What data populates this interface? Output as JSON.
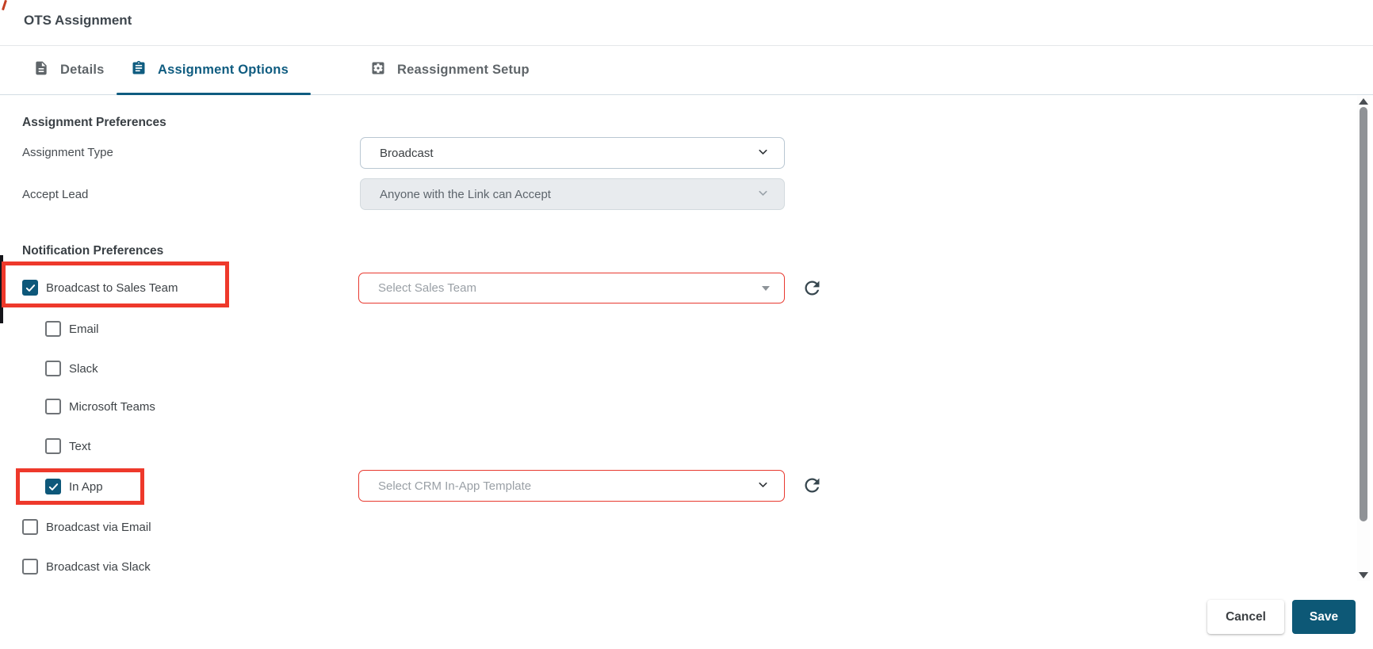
{
  "window": {
    "title": "OTS Assignment"
  },
  "tabs": {
    "details": {
      "label": "Details",
      "active": false
    },
    "assignment_options": {
      "label": "Assignment Options",
      "active": true
    },
    "reassignment_setup": {
      "label": "Reassignment Setup",
      "active": false
    }
  },
  "assignment_preferences": {
    "title": "Assignment Preferences",
    "assignment_type": {
      "label": "Assignment Type",
      "value": "Broadcast",
      "disabled": false
    },
    "accept_lead": {
      "label": "Accept Lead",
      "value": "Anyone with the Link can Accept",
      "disabled": true
    }
  },
  "notification_preferences": {
    "title": "Notification Preferences",
    "broadcast_to_sales_team": {
      "label": "Broadcast to Sales Team",
      "checked": true,
      "annotated": true
    },
    "sales_team_select": {
      "placeholder": "Select Sales Team",
      "error": true
    },
    "email": {
      "label": "Email",
      "checked": false
    },
    "slack": {
      "label": "Slack",
      "checked": false
    },
    "microsoft_teams": {
      "label": "Microsoft Teams",
      "checked": false
    },
    "text": {
      "label": "Text",
      "checked": false
    },
    "in_app": {
      "label": "In App",
      "checked": true,
      "annotated": true
    },
    "crm_template_select": {
      "placeholder": "Select CRM In-App Template",
      "error": true
    },
    "broadcast_via_email": {
      "label": "Broadcast via Email",
      "checked": false
    },
    "broadcast_via_slack": {
      "label": "Broadcast via Slack",
      "checked": false
    }
  },
  "footer": {
    "cancel_label": "Cancel",
    "save_label": "Save"
  },
  "colors": {
    "accent_teal": "#0e587a",
    "active_tab": "#0f5c80",
    "annotation_red": "#ee392b",
    "error_border_red": "#e8392f",
    "disabled_field_bg": "#e8ebee"
  }
}
